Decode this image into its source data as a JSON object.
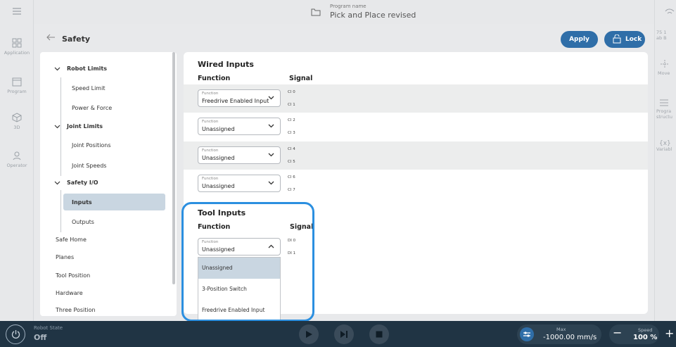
{
  "header": {
    "program_name_label": "Program name",
    "program_name": "Pick and Place revised"
  },
  "left_nav": [
    {
      "label": "Application",
      "icon": "grid-icon"
    },
    {
      "label": "Program",
      "icon": "window-icon"
    },
    {
      "label": "3D",
      "icon": "cube-icon"
    },
    {
      "label": "Operator",
      "icon": "person-icon"
    }
  ],
  "right_rail": {
    "partial_text_1": "75 1",
    "partial_text_2": "ab B",
    "move_label": "Move",
    "program_structure_1": "Progra",
    "program_structure_2": "structu",
    "variables_label": "Variabl"
  },
  "page": {
    "title": "Safety",
    "apply_label": "Apply",
    "lock_label": "Lock"
  },
  "safety_nav": {
    "robot_limits": "Robot Limits",
    "speed_limit": "Speed Limit",
    "power_force": "Power & Force",
    "joint_limits": "Joint Limits",
    "joint_positions": "Joint Positions",
    "joint_speeds": "Joint Speeds",
    "safety_io": "Safety I/O",
    "inputs": "Inputs",
    "outputs": "Outputs",
    "safe_home": "Safe Home",
    "planes": "Planes",
    "tool_position": "Tool Position",
    "hardware": "Hardware",
    "three_position": "Three Position",
    "selected": "Inputs"
  },
  "wired_inputs": {
    "title": "Wired Inputs",
    "function_header": "Function",
    "signal_header": "Signal",
    "rows": [
      {
        "function_label": "Function",
        "value": "Freedrive Enabled Input",
        "signals": [
          "CI 0",
          "CI 1"
        ]
      },
      {
        "function_label": "Function",
        "value": "Unassigned",
        "signals": [
          "CI 2",
          "CI 3"
        ]
      },
      {
        "function_label": "Function",
        "value": "Unassigned",
        "signals": [
          "CI 4",
          "CI 5"
        ]
      },
      {
        "function_label": "Function",
        "value": "Unassigned",
        "signals": [
          "CI 6",
          "CI 7"
        ]
      }
    ]
  },
  "tool_inputs": {
    "title": "Tool Inputs",
    "function_header": "Function",
    "signal_header": "Signal",
    "row": {
      "function_label": "Function",
      "value": "Unassigned",
      "signals": [
        "DI 0",
        "DI 1"
      ]
    },
    "options": [
      "Unassigned",
      "3-Position Switch",
      "Freedrive Enabled Input"
    ],
    "selected_option": "Unassigned"
  },
  "bottom_bar": {
    "robot_state_label": "Robot State",
    "robot_state": "Off",
    "max_label": "Max",
    "max_value": "-1000.00 mm/s",
    "speed_label": "Speed",
    "speed_value": "100 %",
    "minus": "−",
    "plus": "+"
  },
  "colors": {
    "accent": "#2f6ea8",
    "highlight": "#2b8fe0",
    "bottom_bar": "#203444",
    "selected": "#c9d6e1"
  }
}
